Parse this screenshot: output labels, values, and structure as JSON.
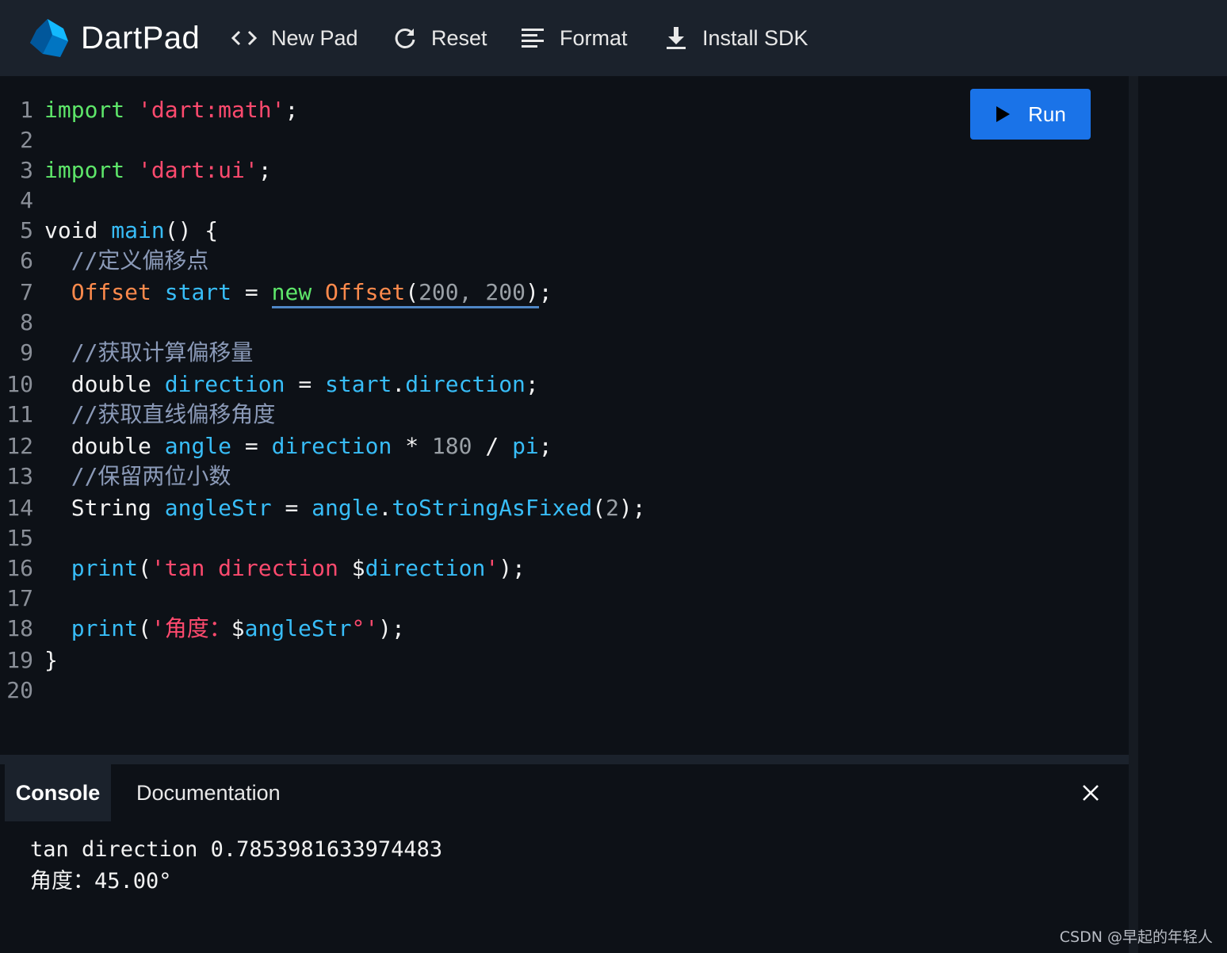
{
  "toolbar": {
    "brand": "DartPad",
    "new_pad": "New Pad",
    "reset": "Reset",
    "format": "Format",
    "install_sdk": "Install SDK"
  },
  "editor": {
    "run_label": "Run",
    "line_numbers": [
      "1",
      "2",
      "3",
      "4",
      "5",
      "6",
      "7",
      "8",
      "9",
      "10",
      "11",
      "12",
      "13",
      "14",
      "15",
      "16",
      "17",
      "18",
      "19",
      "20"
    ],
    "code": {
      "l1_kw": "import",
      "l1_str": "'dart:math'",
      "l1_end": ";",
      "l3_kw": "import",
      "l3_str": "'dart:ui'",
      "l3_end": ";",
      "l5_void": "void",
      "l5_main": "main",
      "l5_rest": "() {",
      "l6_comment": "//定义偏移点",
      "l7_type": "Offset",
      "l7_var": "start",
      "l7_eq": "=",
      "l7_new": "new",
      "l7_ctor": "Offset",
      "l7_open": "(",
      "l7_a1": "200",
      "l7_comma": ", ",
      "l7_a2": "200",
      "l7_close": ")",
      "l7_end": ";",
      "l9_comment": "//获取计算偏移量",
      "l10_type": "double",
      "l10_var": "direction",
      "l10_eq": "=",
      "l10_obj": "start",
      "l10_dot": ".",
      "l10_prop": "direction",
      "l10_end": ";",
      "l11_comment": "//获取直线偏移角度",
      "l12_type": "double",
      "l12_var": "angle",
      "l12_eq": "=",
      "l12_a": "direction",
      "l12_mul": "*",
      "l12_n": "180",
      "l12_div": "/",
      "l12_pi": "pi",
      "l12_end": ";",
      "l13_comment": "//保留两位小数",
      "l14_type": "String",
      "l14_var": "angleStr",
      "l14_eq": "=",
      "l14_obj": "angle",
      "l14_dot": ".",
      "l14_fn": "toStringAsFixed",
      "l14_open": "(",
      "l14_n": "2",
      "l14_close": ")",
      "l14_end": ";",
      "l16_fn": "print",
      "l16_open": "(",
      "l16_str": "'tan direction ",
      "l16_dollar": "$",
      "l16_interp": "direction",
      "l16_q": "'",
      "l16_end": ");",
      "l18_fn": "print",
      "l18_open": "(",
      "l18_str": "'角度：",
      "l18_dollar": "$",
      "l18_interp": "angleStr",
      "l18_deg": "°",
      "l18_q": "'",
      "l18_end": ");",
      "l19_brace": "}"
    }
  },
  "console": {
    "tab_console": "Console",
    "tab_docs": "Documentation",
    "output": [
      "tan direction 0.7853981633974483",
      "角度：45.00°"
    ]
  },
  "watermark": "CSDN @早起的年轻人",
  "colors": {
    "accent_run": "#1a73e8",
    "keyword": "#5ee66a",
    "string": "#ff4a6e",
    "type": "#ff8a4c",
    "identifier": "#38bdf8",
    "comment": "#8b9ab8"
  },
  "icons": [
    "dart-logo-icon",
    "code-brackets-icon",
    "reset-icon",
    "format-icon",
    "download-icon",
    "play-icon",
    "close-icon"
  ]
}
